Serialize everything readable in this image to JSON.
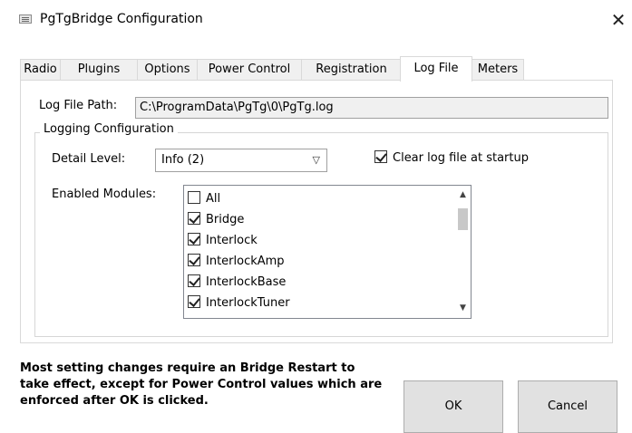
{
  "window": {
    "title": "PgTgBridge Configuration",
    "close_glyph": "✕"
  },
  "tabs": [
    {
      "label": "Radio",
      "active": false
    },
    {
      "label": "Plugins",
      "active": false
    },
    {
      "label": "Options",
      "active": false
    },
    {
      "label": "Power Control",
      "active": false
    },
    {
      "label": "Registration",
      "active": false
    },
    {
      "label": "Log File",
      "active": true
    },
    {
      "label": "Meters",
      "active": false
    }
  ],
  "log_file": {
    "path_label": "Log File Path:",
    "path_value": "C:\\ProgramData\\PgTg\\0\\PgTg.log",
    "group_title": "Logging Configuration",
    "detail_level_label": "Detail Level:",
    "detail_level_value": "Info (2)",
    "clear_log_label": "Clear log file at startup",
    "clear_log_checked": true,
    "enabled_modules_label": "Enabled Modules:",
    "modules": [
      {
        "name": "All",
        "checked": false
      },
      {
        "name": "Bridge",
        "checked": true
      },
      {
        "name": "Interlock",
        "checked": true
      },
      {
        "name": "InterlockAmp",
        "checked": true
      },
      {
        "name": "InterlockBase",
        "checked": true
      },
      {
        "name": "InterlockTuner",
        "checked": true
      }
    ]
  },
  "footer": {
    "note": "Most setting changes require an Bridge Restart to take effect, except for Power Control values which are enforced after OK is clicked.",
    "ok_label": "OK",
    "cancel_label": "Cancel"
  },
  "icons": {
    "app": "app-window-icon",
    "close": "close-icon",
    "dropdown": "chevron-down-icon",
    "scroll_up": "chevron-up-icon",
    "scroll_down": "chevron-down-icon"
  }
}
